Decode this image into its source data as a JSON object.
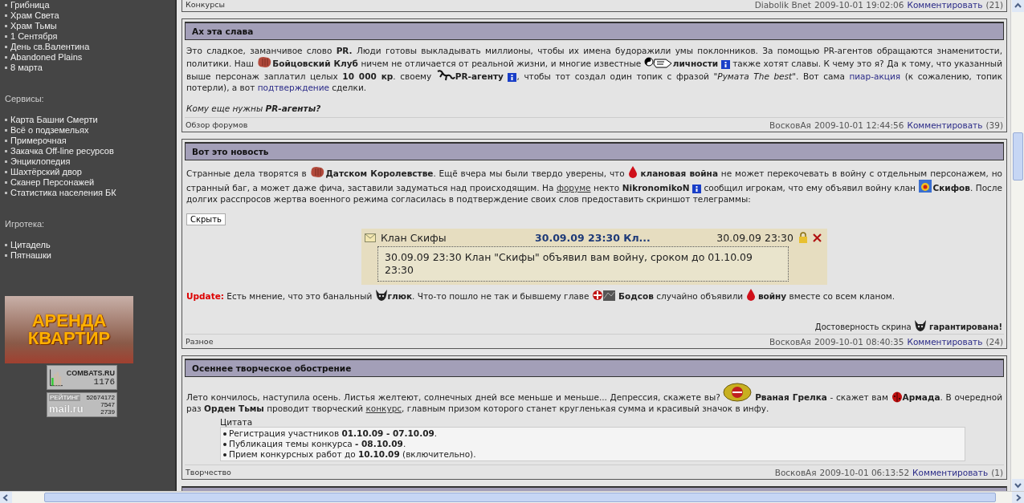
{
  "sidebar": {
    "groups": [
      {
        "items": [
          "Грибница",
          "Храм Света",
          "Храм Тьмы",
          "1 Сентября",
          "День св.Валентина",
          "Abandoned Plains",
          "8 марта"
        ]
      },
      {
        "heading": "Сервисы:",
        "items": [
          "Карта Башни Смерти",
          "Всё о подземельях",
          "Примерочная",
          "Закачка Off-line ресурсов",
          "Энциклопедия",
          "Шахтёрский двор",
          "Сканер Персонажей",
          "Статистика населения БК"
        ]
      },
      {
        "heading": "Игротека:",
        "items": [
          "Цитадель",
          "Пятнашки"
        ]
      }
    ],
    "banner": {
      "line_1": "АРЕНДА",
      "line_2": "КВАРТИР"
    },
    "counter": {
      "site": "COMBATS.RU",
      "hits": "1176"
    },
    "rating": {
      "label": "РЕЙТИНГ",
      "total": "52674172",
      "brand": "mail.ru",
      "value_1": "7547",
      "value_2": "2739"
    }
  },
  "posts": [
    {
      "footer": {
        "category": "Конкурсы",
        "author": "Diabolik Bnet",
        "date": "2009-10-01 19:02:06",
        "comment": "Комментировать",
        "count": "(21)"
      }
    },
    {
      "title": "Ах эта слава",
      "body": [
        {
          "kind": "para",
          "segments": [
            {
              "kind": "text",
              "text": "Это сладкое, заманчивое слово **PR.** Люди готовы выкладывать миллионы, чтобы их имена будоражили умы поклонников. За помощью PR-агентов обращаются знаменитости, политики. Наш "
            },
            {
              "kind": "fist"
            },
            {
              "kind": "text",
              "text": "**Бойцовский Клуб** ничем не отличается от реальной жизни, и многие известные "
            },
            {
              "kind": "hand"
            },
            {
              "kind": "text",
              "text": "**личности** "
            },
            {
              "kind": "info"
            },
            {
              "kind": "text",
              "text": " также хотят славы. К чему это я? Да к тому, что указанный выше персонаж заплатил целых **10 000 кр**. своему "
            },
            {
              "kind": "creature"
            },
            {
              "kind": "text",
              "text": "**PR-агенту** "
            },
            {
              "kind": "info"
            },
            {
              "kind": "text",
              "text": ", чтобы тот создал один топик с фразой \"*Румата The best*\". Вот сама "
            },
            {
              "kind": "link",
              "text": "пиар-акция"
            },
            {
              "kind": "text",
              "text": " (к сожалению, топик потерли), а вот "
            },
            {
              "kind": "link",
              "text": "подтверждение"
            },
            {
              "kind": "text",
              "text": " сделки."
            }
          ]
        },
        {
          "kind": "para",
          "italic": true,
          "segments": [
            {
              "kind": "text",
              "text": "Кому еще нужны **PR-агенты?**"
            }
          ]
        }
      ],
      "footer": {
        "category": "Обзор форумов",
        "author": "ВосковАя",
        "date": "2009-10-01 12:44:56",
        "comment": "Комментировать",
        "count": "(39)"
      }
    },
    {
      "title": "Вот это новость",
      "body": [
        {
          "kind": "para",
          "segments": [
            {
              "kind": "text",
              "text": "Странные дела творятся в "
            },
            {
              "kind": "fist"
            },
            {
              "kind": "text",
              "text": "**Датском Королевстве**. Ещё вчера мы были твердо уверены, что "
            },
            {
              "kind": "drop"
            },
            {
              "kind": "text",
              "text": " **клановая война** не может перекочевать в войну с отдельным персонажем, но странный баг, а может даже фича, заставили задуматься над происходящим. На "
            },
            {
              "kind": "uline",
              "text": "форуме"
            },
            {
              "kind": "text",
              "text": " некто **NikronomikoN** "
            },
            {
              "kind": "info"
            },
            {
              "kind": "text",
              "text": " сообщил игрокам, что ему объявил войну клан "
            },
            {
              "kind": "crest"
            },
            {
              "kind": "text",
              "text": "**Скифов**. После долгих расспросов жертва военного режима согласилась в подтверждение своих слов предоставить скриншот телеграммы:"
            }
          ]
        },
        {
          "kind": "button",
          "label": "Скрыть"
        },
        {
          "kind": "telegram",
          "sender": "Клан Скифы",
          "subject": "30.09.09 23:30 Кл...",
          "time": "30.09.09 23:30",
          "message": "30.09.09 23:30 Клан \"Скифы\" объявил вам войну, сроком до 01.10.09 23:30"
        },
        {
          "kind": "para",
          "segments": [
            {
              "kind": "alert",
              "text": "Update:"
            },
            {
              "kind": "text",
              "text": " Есть мнение, что это банальный "
            },
            {
              "kind": "horns"
            },
            {
              "kind": "text",
              "text": "**глюк**. Что-то пошло не так и бывшему главе "
            },
            {
              "kind": "emblem"
            },
            {
              "kind": "text",
              "text": " **Бодсов** случайно объявили "
            },
            {
              "kind": "drop"
            },
            {
              "kind": "text",
              "text": " **войну** вместе со всем кланом."
            }
          ]
        },
        {
          "kind": "note",
          "segments": [
            {
              "kind": "text",
              "text": "Достоверность скрина "
            },
            {
              "kind": "horns"
            },
            {
              "kind": "text",
              "text": " **гарантирована!**"
            }
          ]
        }
      ],
      "footer": {
        "category": "Разное",
        "author": "ВосковАя",
        "date": "2009-10-01 08:40:35",
        "comment": "Комментировать",
        "count": "(24)"
      }
    },
    {
      "title": "Осеннее творческое обострение",
      "body": [
        {
          "kind": "para",
          "segments": [
            {
              "kind": "text",
              "text": "Лето кончилось, наступила осень. Листья желтеют, солнечных дней все меньше и меньше... Депрессия, скажете вы? "
            },
            {
              "kind": "rosette"
            },
            {
              "kind": "text",
              "text": " **Рваная Грелка** - скажет вам "
            },
            {
              "kind": "beetle"
            },
            {
              "kind": "text",
              "text": "**Армада**. В очередной раз **Орден Тьмы** проводит творческий "
            },
            {
              "kind": "uline",
              "text": "конкурс"
            },
            {
              "kind": "text",
              "text": ", главным призом которого станет кругленькая сумма и красивый значок в инфу."
            }
          ]
        },
        {
          "kind": "quote",
          "label": "Цитата",
          "items": [
            "Регистрация участников **01.10.09 - 07.10.09**.",
            "Публикация темы конкурса **- 08.10.09**.",
            "Прием конкурсных работ до **10.10.09** (включительно)."
          ]
        }
      ],
      "footer": {
        "category": "Творчество",
        "author": "ВосковАя",
        "date": "2009-10-01 06:13:52",
        "comment": "Комментировать",
        "count": "(1)"
      }
    }
  ]
}
